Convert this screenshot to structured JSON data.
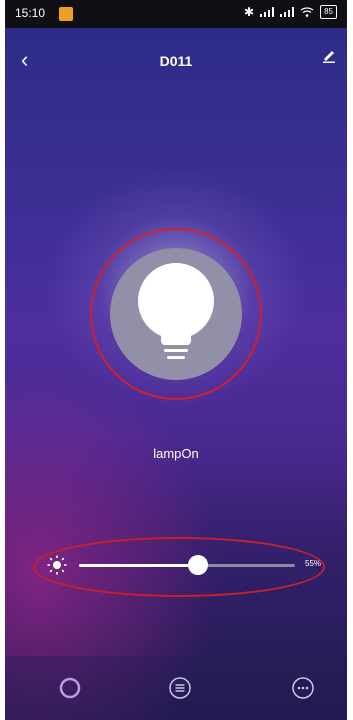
{
  "status": {
    "time": "15:10",
    "battery": "85"
  },
  "header": {
    "title": "D011"
  },
  "lamp": {
    "label": "lampOn"
  },
  "brightness": {
    "percent_label": "55%",
    "level": 0.55
  },
  "icons": {
    "back": "back-chevron-icon",
    "edit": "edit-pencil-icon",
    "lamp": "lightbulb-icon",
    "sun": "sun-brightness-icon",
    "tab_color": "color-ring-icon",
    "tab_list": "list-icon",
    "tab_more": "more-icon"
  },
  "colors": {
    "highlight_ring": "#d0202a",
    "tab_active": "#b59cf0"
  }
}
